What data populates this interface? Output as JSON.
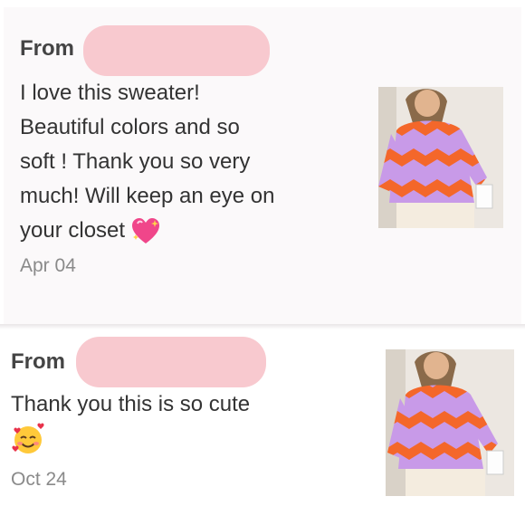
{
  "messages": [
    {
      "from_label": "From",
      "text_lines": [
        "I love this sweater!",
        "Beautiful colors and so",
        "soft ! Thank you so very",
        "much! Will keep an eye on",
        "your closet"
      ],
      "emoji": "sparkling-heart-icon",
      "date": "Apr 04"
    },
    {
      "from_label": "From",
      "text": "Thank you this is so cute",
      "emoji": "smiling-face-with-hearts-icon",
      "date": "Oct 24"
    }
  ],
  "colors": {
    "redaction": "#f8c9cf",
    "sweater_orange": "#f4672a",
    "sweater_lavender": "#c89ae8"
  }
}
